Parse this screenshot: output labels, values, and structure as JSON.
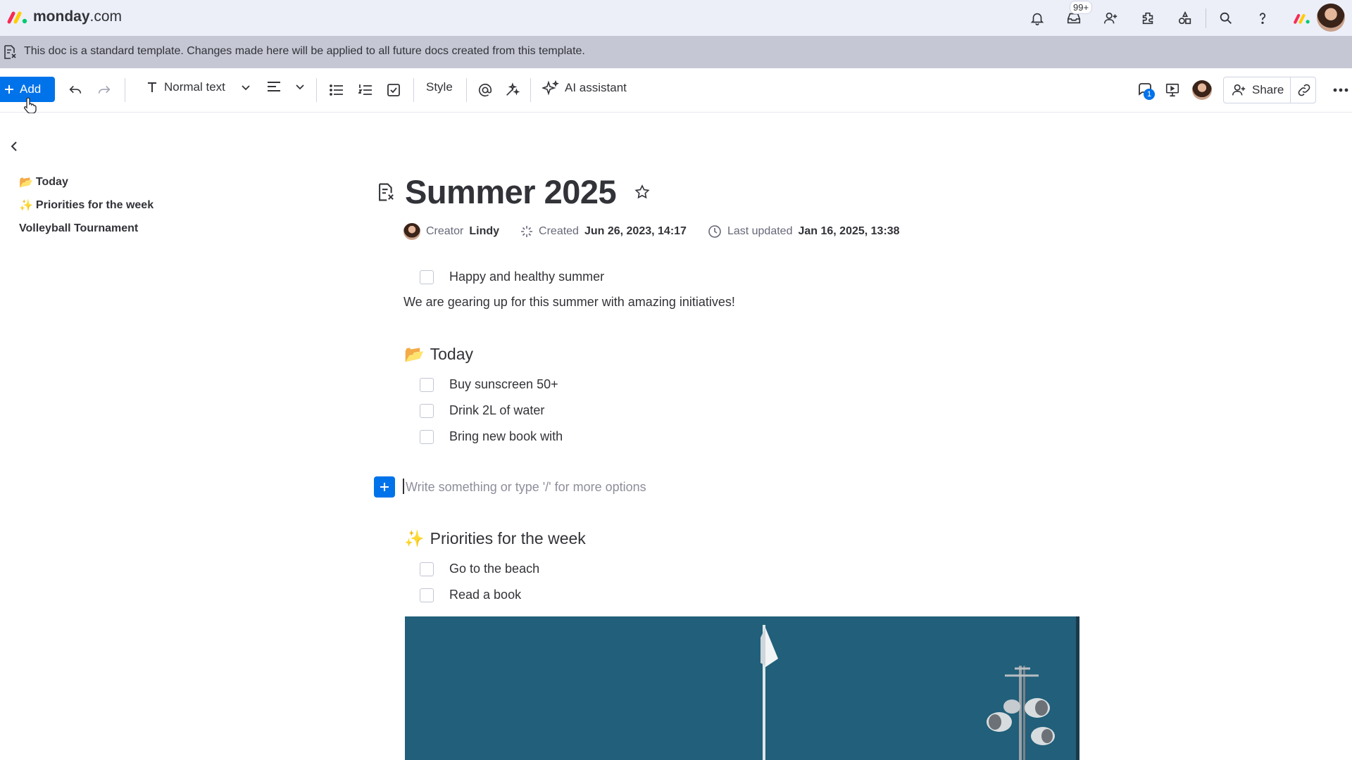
{
  "app": {
    "brand_bold": "monday",
    "brand_suffix": ".com",
    "inbox_badge": "99+"
  },
  "banner": {
    "text": "This doc is a standard template. Changes made here will be applied to all future docs created from this template."
  },
  "toolbar": {
    "add_label": "Add",
    "text_style": "Normal text",
    "style_label": "Style",
    "ai_label": "AI assistant",
    "share_label": "Share",
    "updates_badge": "1"
  },
  "sidebar": {
    "items": [
      {
        "emoji": "📂",
        "label": "Today"
      },
      {
        "emoji": "✨",
        "label": "Priorities for the week"
      },
      {
        "emoji": "",
        "label": "Volleyball Tournament"
      }
    ]
  },
  "doc": {
    "title": "Summer 2025",
    "creator_label": "Creator",
    "creator_name": "Lindy",
    "created_label": "Created",
    "created_value": "Jun 26, 2023, 14:17",
    "updated_label": "Last updated",
    "updated_value": "Jan 16, 2025, 13:38",
    "top_checklist": [
      {
        "text": "Happy and healthy summer",
        "checked": false
      }
    ],
    "intro": "We are gearing up for this summer with amazing initiatives!",
    "sections": [
      {
        "emoji": "📂",
        "heading": "Today",
        "items": [
          {
            "text": "Buy sunscreen 50+",
            "checked": false
          },
          {
            "text": "Drink 2L of water",
            "checked": false
          },
          {
            "text": "Bring new book with",
            "checked": false
          }
        ]
      },
      {
        "emoji": "✨",
        "heading": "Priorities for the week",
        "items": [
          {
            "text": "Go to the beach",
            "checked": false
          },
          {
            "text": "Read a book",
            "checked": false
          }
        ]
      }
    ],
    "placeholder": "Write something or type '/' for more options"
  },
  "colors": {
    "accent": "#0073ea",
    "banner": "#c5c7d4",
    "topbar": "#eceff8"
  },
  "icons": [
    "bell-icon",
    "inbox-icon",
    "invite-members-icon",
    "apps-icon",
    "integrations-icon",
    "search-icon",
    "help-icon",
    "template-doc-icon",
    "undo-icon",
    "redo-icon",
    "text-type-icon",
    "align-left-icon",
    "bullet-list-icon",
    "numbered-list-icon",
    "checklist-icon",
    "mention-icon",
    "magic-icon",
    "ai-sparkle-icon",
    "comments-icon",
    "presentation-icon",
    "share-person-icon",
    "link-icon",
    "more-icon",
    "star-icon",
    "sparkle-icon",
    "clock-icon",
    "chevron-left-icon",
    "plus-icon",
    "folder-emoji-icon"
  ]
}
